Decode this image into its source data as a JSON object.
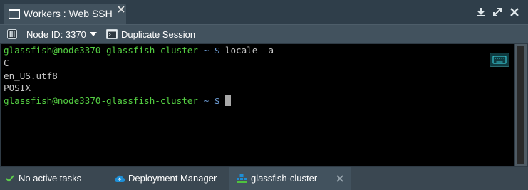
{
  "window": {
    "tab_title": "Workers : Web SSH"
  },
  "toolbar": {
    "node_label": "Node ID: 3370",
    "duplicate_label": "Duplicate Session"
  },
  "terminal": {
    "prompt": "glassfish@node3370-glassfish-cluster",
    "tilde": "~ $",
    "lines": [
      {
        "command": " locale -a"
      },
      {
        "output": "C"
      },
      {
        "output": "en_US.utf8"
      },
      {
        "output": "POSIX"
      },
      {
        "command": " "
      }
    ]
  },
  "statusbar": {
    "tasks_label": "No active tasks",
    "deploy_label": "Deployment Manager",
    "env_label": "glassfish-cluster"
  },
  "colors": {
    "prompt": "#55d043",
    "tilde": "#6f9fd8",
    "accent": "#1e8fd6"
  }
}
